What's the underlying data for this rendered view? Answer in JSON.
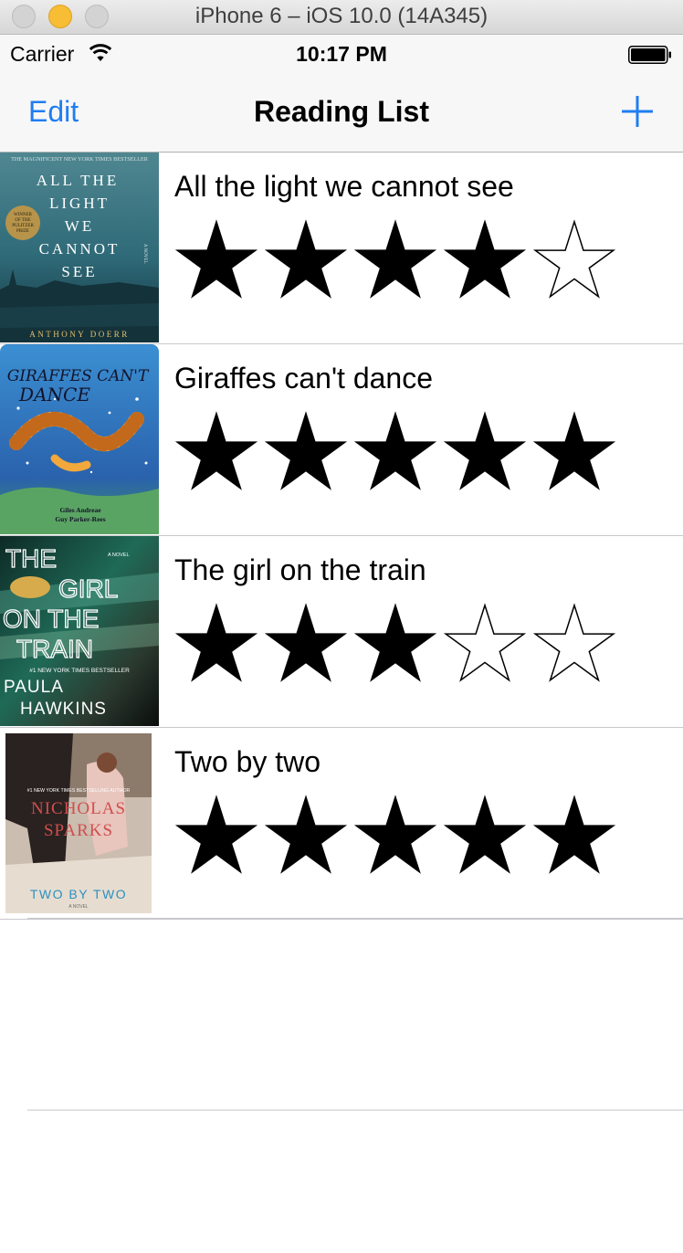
{
  "simulator": {
    "title": "iPhone 6 – iOS 10.0 (14A345)"
  },
  "statusbar": {
    "carrier": "Carrier",
    "time": "10:17 PM",
    "wifi_icon": "wifi-icon",
    "battery_icon": "battery-icon"
  },
  "navbar": {
    "edit_label": "Edit",
    "title": "Reading List",
    "add_icon": "plus-icon",
    "tint_color": "#1f7ef2"
  },
  "books": [
    {
      "title": "All the light we cannot see",
      "rating": 4,
      "max_rating": 5,
      "cover": {
        "top_text": "THE MAGNIFICENT NEW YORK TIMES BESTSELLER",
        "lines": [
          "ALL THE",
          "LIGHT",
          "WE",
          "CANNOT",
          "SEE"
        ],
        "badge": [
          "WINNER",
          "OF THE",
          "PULITZER",
          "PRIZE"
        ],
        "side": "A NOVEL",
        "author": "ANTHONY DOERR"
      }
    },
    {
      "title": "Giraffes can't dance",
      "rating": 5,
      "max_rating": 5,
      "cover": {
        "lines": [
          "GIRAFFES CAN'T",
          "DANCE"
        ],
        "author": "Giles Andreae",
        "illustrator": "Guy Parker-Rees"
      }
    },
    {
      "title": "The girl on the train",
      "rating": 3,
      "max_rating": 5,
      "cover": {
        "lines": [
          "THE",
          "GIRL",
          "ON THE",
          "TRAIN"
        ],
        "side": "A NOVEL",
        "tag": "#1 NEW YORK TIMES BESTSELLER",
        "author_first": "PAULA",
        "author_last": "HAWKINS"
      }
    },
    {
      "title": "Two by two",
      "rating": 5,
      "max_rating": 5,
      "cover": {
        "tag": "#1 NEW YORK TIMES BESTSELLING AUTHOR",
        "author_first": "NICHOLAS",
        "author_last": "SPARKS",
        "book": "TWO BY TWO",
        "side": "A NOVEL"
      }
    }
  ]
}
